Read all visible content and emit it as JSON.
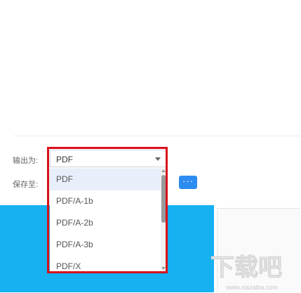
{
  "labels": {
    "output_as": "输出为:",
    "save_to": "保存至:"
  },
  "format_select": {
    "value": "PDF",
    "options": [
      "PDF",
      "PDF/A-1b",
      "PDF/A-2b",
      "PDF/A-3b",
      "PDF/X"
    ],
    "selected_index": 0
  },
  "more_button": {
    "label": "···"
  },
  "colors": {
    "accent_blue": "#2d8cf0",
    "banner_blue": "#16b1f1",
    "highlight_red": "#d9111b",
    "selected_bg": "#e8eefa"
  },
  "watermark": {
    "text": "下载吧",
    "url": "www.xiazaiba.com"
  }
}
